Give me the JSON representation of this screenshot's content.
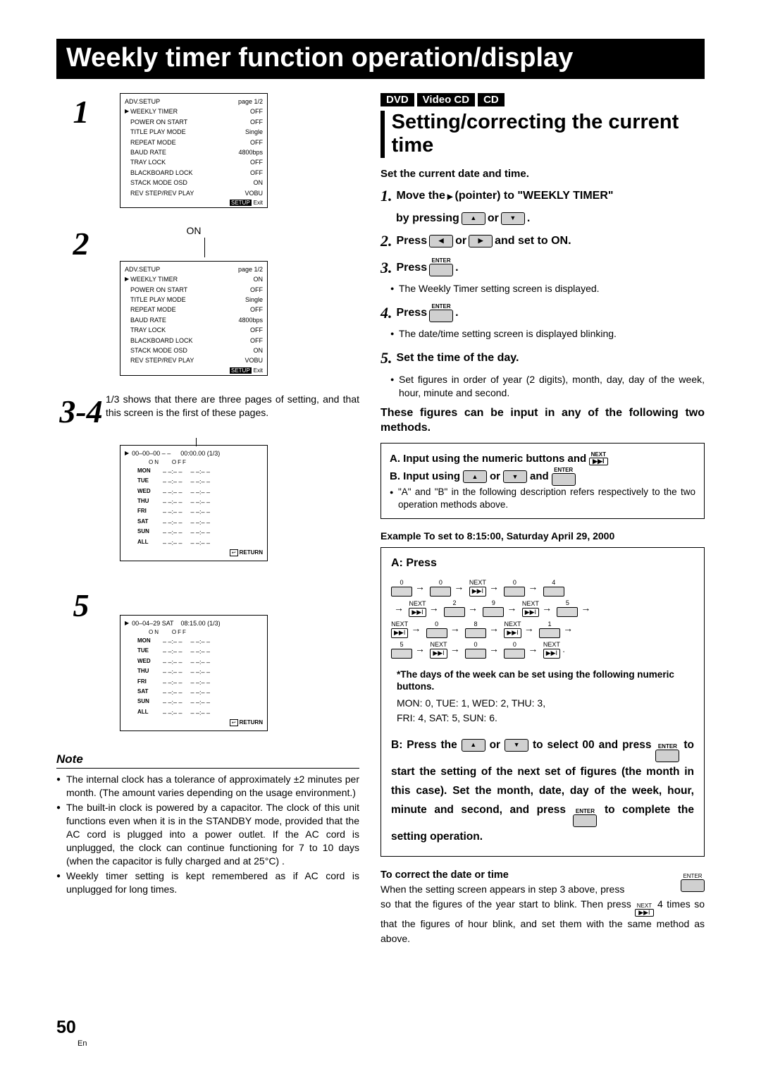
{
  "title": "Weekly timer function operation/display",
  "left": {
    "step1_menu": {
      "page": "page 1/2",
      "rows": [
        {
          "l": "ADV.SETUP",
          "r": ""
        },
        {
          "l": "WEEKLY TIMER",
          "r": "OFF",
          "ptr": true
        },
        {
          "l": "POWER ON START",
          "r": "OFF"
        },
        {
          "l": "TITLE PLAY MODE",
          "r": "Single"
        },
        {
          "l": "REPEAT MODE",
          "r": "OFF"
        },
        {
          "l": "BAUD RATE",
          "r": "4800bps"
        },
        {
          "l": "TRAY LOCK",
          "r": "OFF"
        },
        {
          "l": "BLACKBOARD LOCK",
          "r": "OFF"
        },
        {
          "l": "STACK MODE OSD",
          "r": "ON"
        },
        {
          "l": "REV STEP/REV PLAY",
          "r": "VOBU"
        }
      ],
      "exit": "Exit",
      "setup": "SETUP"
    },
    "on_label": "ON",
    "step2_menu": {
      "page": "page 1/2",
      "rows": [
        {
          "l": "ADV.SETUP",
          "r": ""
        },
        {
          "l": "WEEKLY TIMER",
          "r": "ON",
          "ptr": true
        },
        {
          "l": "POWER ON START",
          "r": "OFF"
        },
        {
          "l": "TITLE PLAY MODE",
          "r": "Single"
        },
        {
          "l": "REPEAT MODE",
          "r": "OFF"
        },
        {
          "l": "BAUD RATE",
          "r": "4800bps"
        },
        {
          "l": "TRAY LOCK",
          "r": "OFF"
        },
        {
          "l": "BLACKBOARD LOCK",
          "r": "OFF"
        },
        {
          "l": "STACK MODE OSD",
          "r": "ON"
        },
        {
          "l": "REV STEP/REV PLAY",
          "r": "VOBU"
        }
      ],
      "exit": "Exit",
      "setup": "SETUP"
    },
    "step34_text": "1/3 shows that there are three pages of setting, and that this screen is the first of these pages.",
    "timer_box1": {
      "head": "00–00–00 – –",
      "time": "00:00.00 (1/3)",
      "on": "ON",
      "off": "OFF",
      "days": [
        "MON",
        "TUE",
        "WED",
        "THU",
        "FRI",
        "SAT",
        "SUN",
        "ALL"
      ],
      "blank": "– –:– –",
      "return": "RETURN"
    },
    "timer_box2": {
      "head": "00–04–29  SAT",
      "time": "08:15.00 (1/3)",
      "on": "ON",
      "off": "OFF",
      "days": [
        "MON",
        "TUE",
        "WED",
        "THU",
        "FRI",
        "SAT",
        "SUN",
        "ALL"
      ],
      "blank": "– –:– –",
      "return": "RETURN"
    },
    "note_heading": "Note",
    "notes": [
      "The internal clock has a tolerance of approximately ±2 minutes per month. (The amount varies depending on the usage environment.)",
      "The built-in clock is powered by a capacitor. The clock of this unit functions even when it is in the STANDBY mode, provided that the AC cord is plugged into a power outlet. If the AC cord is unplugged, the clock can continue functioning for 7 to 10 days (when the capacitor is fully charged and at 25°C) .",
      "Weekly timer setting is kept remembered as if AC cord is unplugged for long times."
    ]
  },
  "right": {
    "tags": [
      "DVD",
      "Video CD",
      "CD"
    ],
    "heading": "Setting/correcting the current time",
    "set_line": "Set the current date and time.",
    "step1a": "Move the",
    "step1b": "(pointer) to \"WEEKLY TIMER\"",
    "step1c": "by pressing",
    "step1d": "or",
    "step1e": ".",
    "step2a": "Press",
    "step2b": "or",
    "step2c": "and set to ON.",
    "step3a": "Press",
    "step3_enter": "ENTER",
    "step3dot": ".",
    "step3_sub": "The Weekly Timer setting screen is displayed.",
    "step4a": "Press",
    "step4dot": ".",
    "step4_sub": "The date/time setting screen is displayed blinking.",
    "step5a": "Set the time of the day.",
    "step5_sub": "Set figures in order of year (2 digits), month, day, day of the week, hour, minute and second.",
    "following": "These figures can be input in any of the following two methods.",
    "methodA": "A. Input using the numeric buttons and",
    "methodB": "B. Input using",
    "methodB_or": "or",
    "methodB_and": "and",
    "method_note": "\"A\" and \"B\" in the following description refers respectively to the two operation methods above.",
    "next_label": "NEXT",
    "enter_label": "ENTER",
    "example_line": "Example   To set to 8:15:00, Saturday April 29, 2000",
    "a_press": "A: Press",
    "seq": [
      "0",
      "0",
      "NEXT",
      "0",
      "4",
      "NEXT",
      "2",
      "9",
      "NEXT",
      "5",
      "NEXT",
      "0",
      "8",
      "NEXT",
      "1",
      "5",
      "NEXT",
      "0",
      "0",
      "NEXT"
    ],
    "smallnote": "*The days of the week can be set using the following numeric buttons.",
    "daymap1": "MON: 0,    TUE: 1,    WED: 2,    THU: 3,",
    "daymap2": "FRI: 4,     SAT: 5,     SUN: 6.",
    "b1": "B: Press the",
    "b2": "or",
    "b3": "to select 00 and",
    "b4": "press",
    "b5": "to start the setting of the next set of figures (the month in this case). Set the month, date, day of the week, hour, minute and second, and press",
    "b6": "to complete the setting operation.",
    "correct_head": "To correct the date or time",
    "correct_text1": "When the setting screen appears in step 3 above, press",
    "correct_text2": "so that the figures of the year start to blink. Then press",
    "correct_text3": "4 times so that the figures of hour blink, and set them with the same method as above."
  },
  "page_number": "50",
  "lang": "En"
}
